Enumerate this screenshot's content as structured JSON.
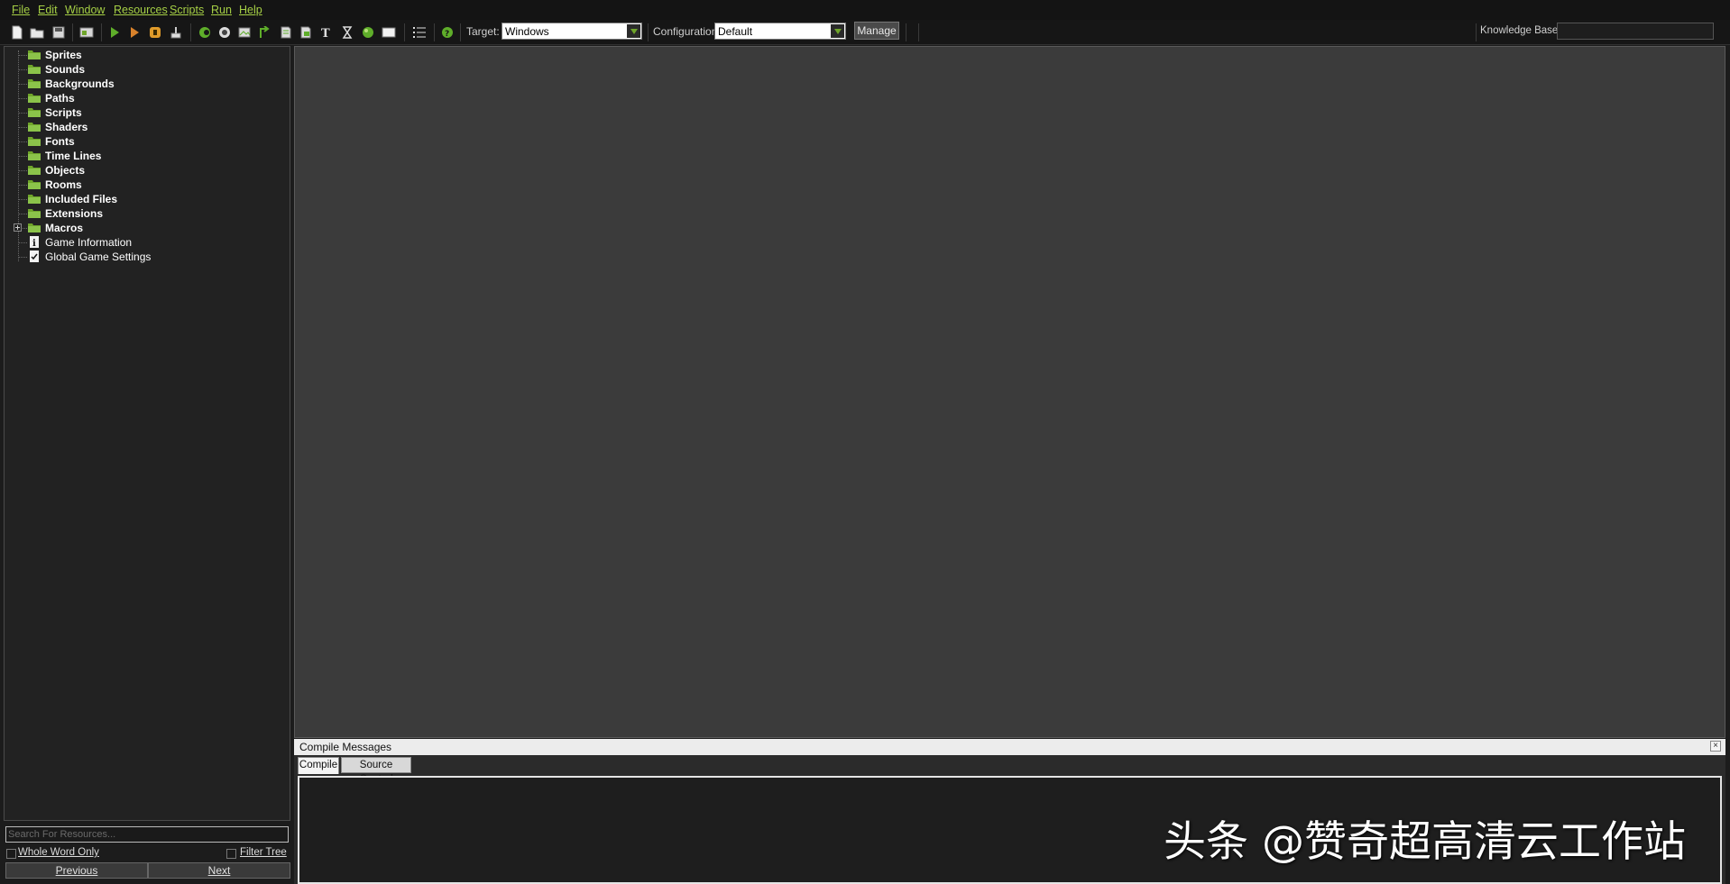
{
  "menu": [
    "File",
    "Edit",
    "Window",
    "Resources",
    "Scripts",
    "Run",
    "Help"
  ],
  "toolbar": {
    "target_label": "Target:",
    "target_value": "Windows",
    "configuration_label": "Configuration:",
    "configuration_value": "Default",
    "manage_label": "Manage",
    "knowledge_base_label": "Knowledge Base:"
  },
  "tree": {
    "folders": [
      "Sprites",
      "Sounds",
      "Backgrounds",
      "Paths",
      "Scripts",
      "Shaders",
      "Fonts",
      "Time Lines",
      "Objects",
      "Rooms",
      "Included Files",
      "Extensions",
      "Macros"
    ],
    "items": [
      "Game Information",
      "Global Game Settings"
    ]
  },
  "search": {
    "placeholder": "Search For Resources...",
    "whole_word_label": "Whole Word Only",
    "filter_tree_label": "Filter Tree",
    "previous_label": "Previous",
    "next_label": "Next"
  },
  "compile_panel": {
    "title": "Compile Messages",
    "tabs": [
      "Compile",
      "Source Control"
    ]
  },
  "watermark": "头条 @赞奇超高清云工作站",
  "colors": {
    "accent_green": "#a5cf45",
    "folder_green": "#6fa52a",
    "workspace_bg": "#3b3b3b"
  }
}
